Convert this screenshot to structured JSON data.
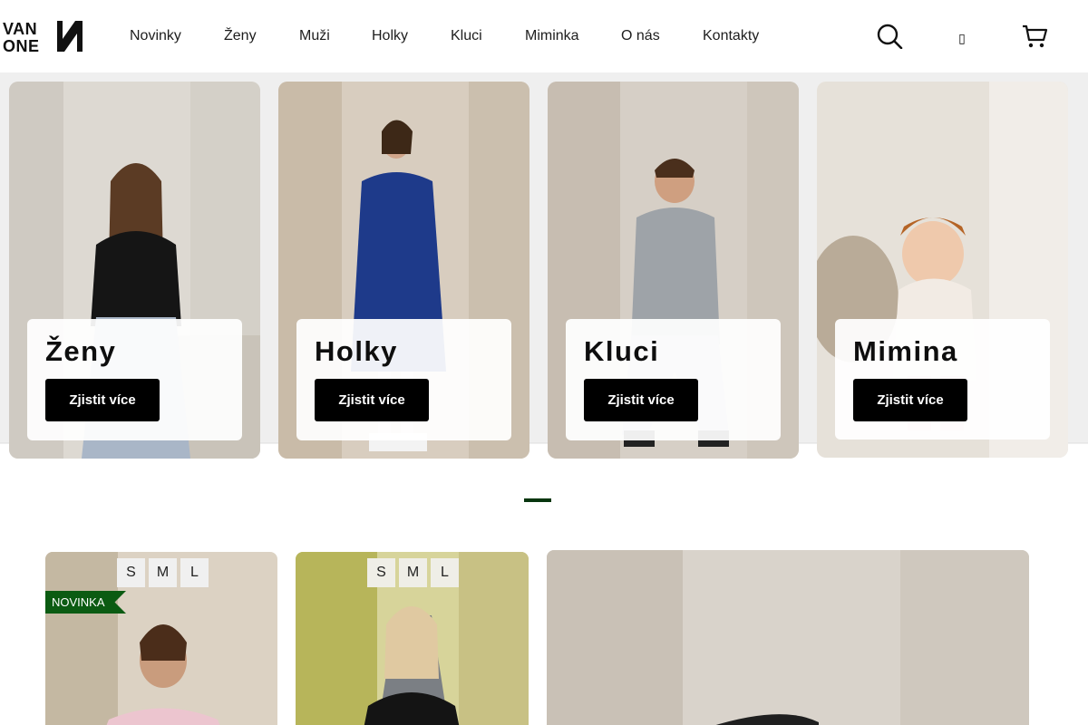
{
  "brand": {
    "logo_top": "VAN",
    "logo_bottom": "ONE"
  },
  "nav": {
    "items": [
      "Novinky",
      "Ženy",
      "Muži",
      "Holky",
      "Kluci",
      "Miminka",
      "O nás",
      "Kontakty"
    ]
  },
  "header_icons": {
    "search": "search-icon",
    "user": "",
    "user_icon": "user-icon",
    "cart": "cart-icon"
  },
  "categories": [
    {
      "title": "Ženy",
      "button": "Zjistit více"
    },
    {
      "title": "Holky",
      "button": "Zjistit více"
    },
    {
      "title": "Kluci",
      "button": "Zjistit více"
    },
    {
      "title": "Mimina",
      "button": "Zjistit více"
    }
  ],
  "products": [
    {
      "sizes": [
        "S",
        "M",
        "L"
      ],
      "badge": "NOVINKA"
    },
    {
      "sizes": [
        "S",
        "M",
        "L"
      ]
    },
    {}
  ],
  "colors": {
    "accent_green": "#0b5b12",
    "button_black": "#000000",
    "slider_indicator": "#07360f"
  }
}
